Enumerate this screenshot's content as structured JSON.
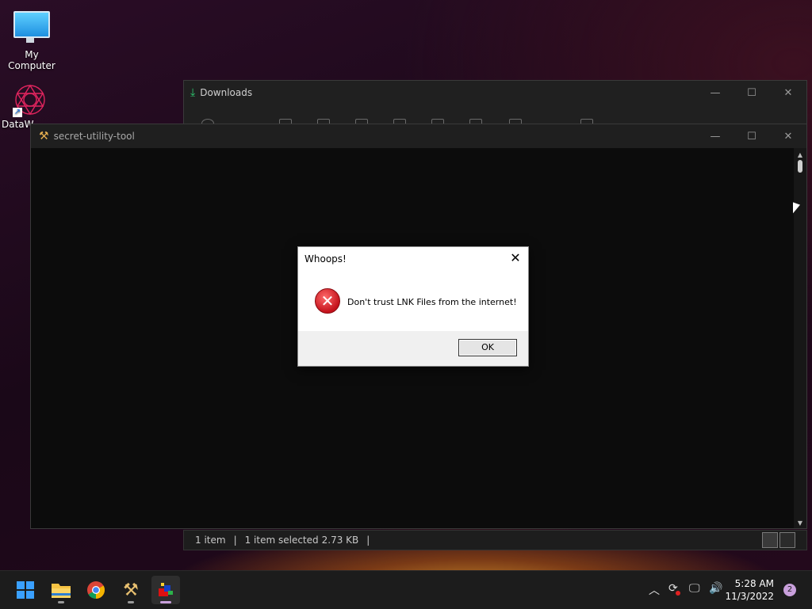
{
  "desktop": {
    "icons": [
      {
        "label": "My Computer",
        "icon": "computer-icon"
      },
      {
        "label": "DataW",
        "icon": "datawave-shortcut-icon"
      }
    ]
  },
  "downloads_window": {
    "title": "Downloads",
    "status": {
      "items": "1 item",
      "selected": "1 item selected",
      "size": "2.73 KB",
      "sep": "|"
    }
  },
  "main_window": {
    "title": "secret-utility-tool"
  },
  "dialog": {
    "title": "Whoops!",
    "message": "Don't trust LNK Files from the internet!",
    "ok_label": "OK",
    "close_glyph": "✕",
    "icon": "error-icon"
  },
  "window_controls": {
    "minimize": "—",
    "maximize": "☐",
    "close": "✕"
  },
  "taskbar": {
    "apps": [
      "start-icon",
      "file-explorer-icon",
      "chrome-icon",
      "tool-icon",
      "secret-utility-icon"
    ],
    "time": "5:28 AM",
    "date": "11/3/2022",
    "notification_count": "2"
  },
  "colors": {
    "accent": "#0078d4",
    "error": "#c4121b"
  }
}
